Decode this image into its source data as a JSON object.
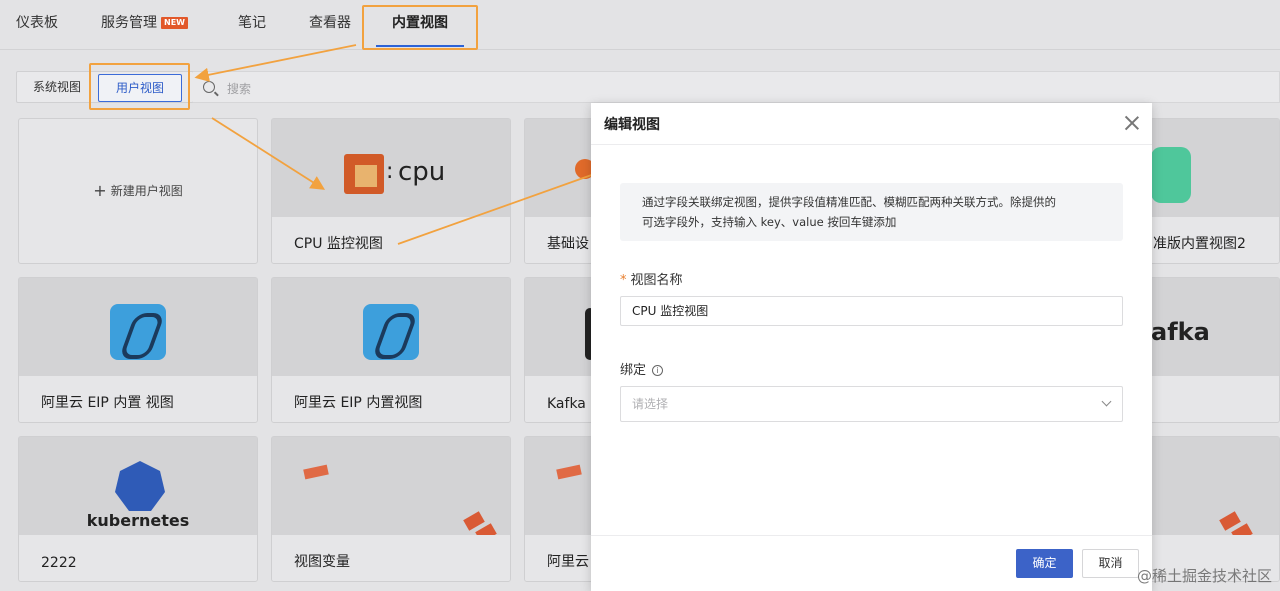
{
  "nav": {
    "tabs": [
      {
        "label": "仪表板"
      },
      {
        "label": "服务管理",
        "badge": "NEW"
      },
      {
        "label": "笔记"
      },
      {
        "label": "查看器"
      },
      {
        "label": "内置视图"
      }
    ]
  },
  "view_switch": {
    "system": "系统视图",
    "user": "用户视图"
  },
  "search": {
    "placeholder": "搜索"
  },
  "cards": {
    "new_view": "新建用户视图",
    "cpu_logo_text": "cpu",
    "kafka_logo_text": "afka",
    "k8s_logo_text": "kubernetes",
    "titles": [
      "CPU 监控视图",
      "基础设",
      "准版内置视图2",
      "阿里云 EIP 内置 视图",
      "阿里云 EIP 内置视图",
      "Kafka I",
      "2222",
      "视图变量",
      "阿里云"
    ]
  },
  "modal": {
    "title": "编辑视图",
    "info_line1": "通过字段关联绑定视图，提供字段值精准匹配、模糊匹配两种关联方式。除提供的",
    "info_line2": "可选字段外，支持输入 key、value 按回车键添加",
    "name_label": "视图名称",
    "name_required_mark": "*",
    "name_value": "CPU 监控视图",
    "bind_label": "绑定",
    "bind_placeholder": "请选择",
    "ok": "确定",
    "cancel": "取消"
  },
  "watermark": "@稀土掘金技术社区",
  "colors": {
    "accent": "#3c63c8",
    "annotation": "#f2a23f",
    "badge": "#e2582a"
  }
}
